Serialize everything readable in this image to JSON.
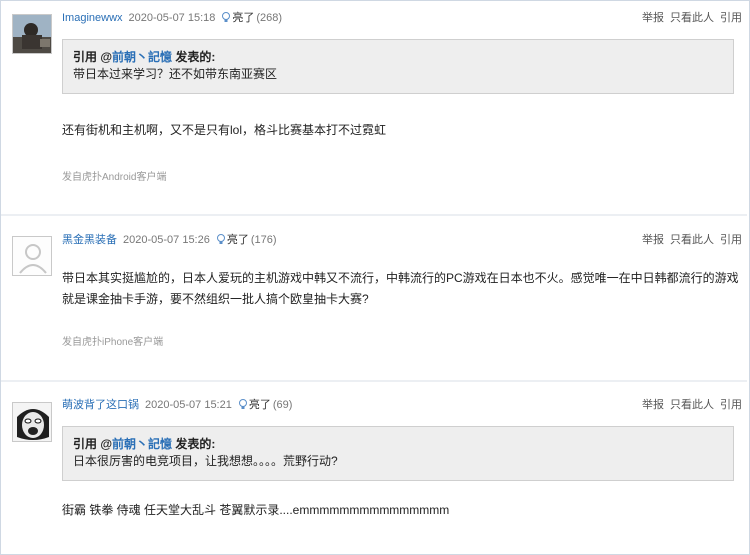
{
  "posts": [
    {
      "username": "Imaginewwx",
      "time": "2020-05-07 15:18",
      "light_label": "亮了",
      "light_count": "(268)",
      "actions": [
        "举报",
        "只看此人",
        "引用"
      ],
      "quote": {
        "prefix": "引用 @",
        "user": "前朝丶記憶",
        "suffix": " 发表的:",
        "text": "带日本过来学习？还不如带东南亚赛区"
      },
      "body": "还有街机和主机啊，又不是只有lol，格斗比赛基本打不过霓虹",
      "from": "发自虎扑Android客户端"
    },
    {
      "username": "黑金黑装备",
      "time": "2020-05-07 15:26",
      "light_label": "亮了",
      "light_count": "(176)",
      "actions": [
        "举报",
        "只看此人",
        "引用"
      ],
      "body_line1": "带日本其实挺尴尬的，日本人爱玩的主机游戏中韩又不流行，中韩流行的PC游戏在日本也不火。感觉唯一在中日韩都流行的游戏",
      "body_line2": "就是课金抽卡手游，要不然组织一批人搞个欧皇抽卡大赛?",
      "from": "发自虎扑iPhone客户端"
    },
    {
      "username": "萌波背了这口锅",
      "time": "2020-05-07 15:21",
      "light_label": "亮了",
      "light_count": "(69)",
      "actions": [
        "举报",
        "只看此人",
        "引用"
      ],
      "quote": {
        "prefix": "引用 @",
        "user": "前朝丶記憶",
        "suffix": " 发表的:",
        "text": "日本很厉害的电竞项目，让我想想。。。。荒野行动?"
      },
      "body": "街霸 铁拳 侍魂 任天堂大乱斗 苍翼默示录....emmmmmmmmmmmmmmm"
    }
  ],
  "colors": {
    "username": "#2a6fb6",
    "quote_bg": "#eeeeee",
    "separator": "#eceff3"
  }
}
